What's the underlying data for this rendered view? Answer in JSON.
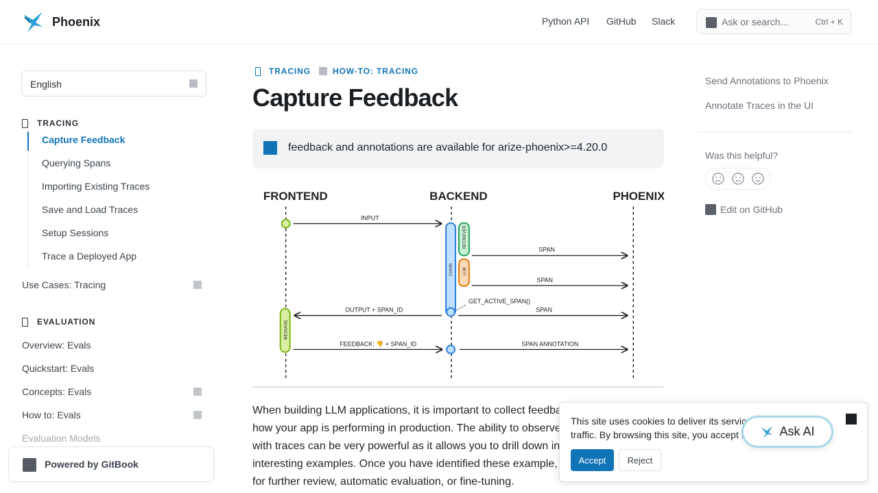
{
  "app": {
    "name": "Phoenix"
  },
  "header": {
    "links": [
      "Python API",
      "GitHub",
      "Slack"
    ],
    "search_placeholder": "Ask or search...",
    "search_shortcut": "Ctrl + K"
  },
  "sidebar": {
    "language": "English",
    "tracing_section": "TRACING",
    "tracing_items": [
      "Capture Feedback",
      "Querying Spans",
      "Importing Existing Traces",
      "Save and Load Traces",
      "Setup Sessions",
      "Trace a Deployed App"
    ],
    "use_cases_tracing": "Use Cases: Tracing",
    "evaluation_section": "EVALUATION",
    "evaluation_items": [
      "Overview: Evals",
      "Quickstart: Evals",
      "Concepts: Evals",
      "How to: Evals",
      "Evaluation Models"
    ],
    "powered_by": "Powered by GitBook"
  },
  "main": {
    "breadcrumb": [
      "TRACING",
      "HOW-TO: TRACING"
    ],
    "title": "Capture Feedback",
    "hint": "feedback and annotations are available for arize-phoenix>=4.20.0",
    "diagram": {
      "columns": [
        "FRONTEND",
        "BACKEND",
        "PHOENIX"
      ],
      "labels": [
        "INPUT",
        "SPAN",
        "SPAN",
        "GET_ACTIVE_SPAN()",
        "OUTPUT + SPAN_ID",
        "SPAN",
        "FEEDBACK: 👎 + SPAN_ID",
        "SPAN ANNOTATION"
      ],
      "component_labels": [
        "CHAIN",
        "RETRIEVER",
        "LLM",
        "MESSAGE"
      ]
    },
    "body": "When building LLM applications, it is important to collect feedback to understand how your app is performing in production. The ability to observe user feedback along with traces can be very powerful as it allows you to drill down into the most interesting examples. Once you have identified these example, you can share them for further review, automatic evaluation, or fine-tuning."
  },
  "rail": {
    "toc": [
      "Send Annotations to Phoenix",
      "Annotate Traces in the UI"
    ],
    "helpful": "Was this helpful?",
    "edit": "Edit on GitHub"
  },
  "cookie": {
    "text": "This site uses cookies to deliver its service and to analyse traffic. By browsing this site, you accept the privacy policy.",
    "accept": "Accept",
    "reject": "Reject"
  },
  "ask_ai": "Ask AI",
  "colors": {
    "accent": "#1174b6",
    "text": "#1f2328",
    "muted": "#6b7079"
  }
}
